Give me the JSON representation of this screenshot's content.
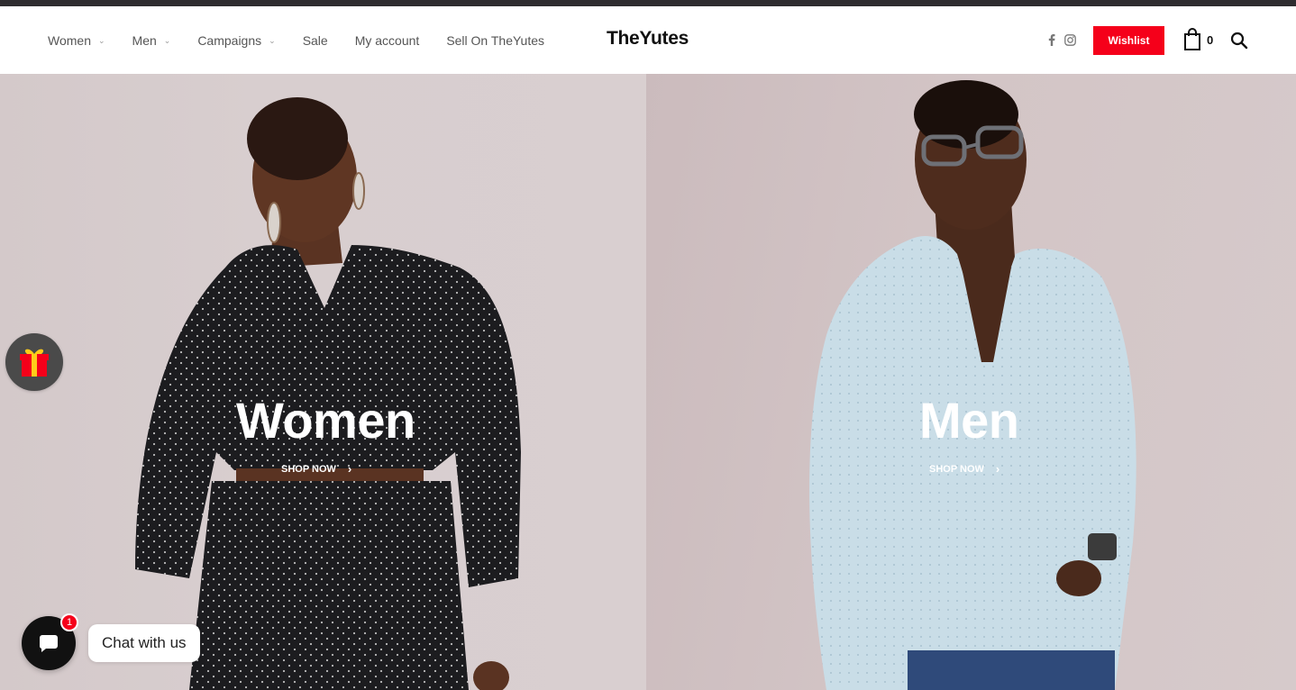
{
  "header": {
    "nav": [
      {
        "label": "Women",
        "has_dropdown": true
      },
      {
        "label": "Men",
        "has_dropdown": true
      },
      {
        "label": "Campaigns",
        "has_dropdown": true
      },
      {
        "label": "Sale",
        "has_dropdown": false
      },
      {
        "label": "My account",
        "has_dropdown": false
      },
      {
        "label": "Sell On TheYutes",
        "has_dropdown": false
      }
    ],
    "chevron": "⌄",
    "logo": "TheYutes",
    "social": [
      {
        "icon": "facebook-icon"
      },
      {
        "icon": "instagram-icon"
      }
    ],
    "wishlist_label": "Wishlist",
    "cart_count": "0",
    "search_icon": "search-icon"
  },
  "hero": {
    "women": {
      "title": "Women",
      "cta": "SHOP NOW",
      "arrow": "›"
    },
    "men": {
      "title": "Men",
      "cta": "SHOP NOW",
      "arrow": "›"
    }
  },
  "widgets": {
    "gift_icon": "gift-icon",
    "chat_badge": "1",
    "chat_label": "Chat with us"
  },
  "colors": {
    "accent": "#f5001a",
    "top_strip": "#2e2c2f",
    "nav_text": "#555555",
    "hero_bg": "#d8cecf"
  }
}
